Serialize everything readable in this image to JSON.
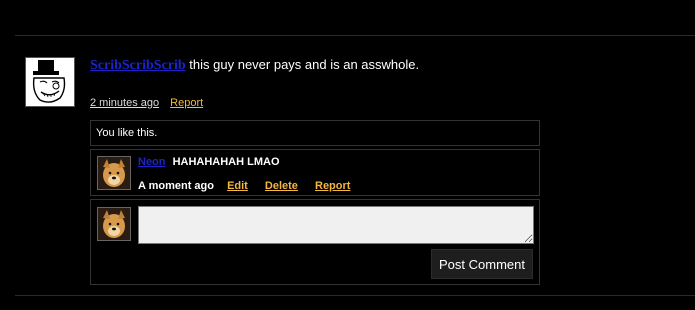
{
  "post": {
    "username": "ScribScribScrib",
    "text": "this guy never pays and is an asswhole.",
    "time": "2 minutes ago",
    "report_label": "Report"
  },
  "likes": {
    "text": "You like this."
  },
  "reply": {
    "username": "Neon",
    "text": "HAHAHAHAH LMAO",
    "time": "A moment ago",
    "edit_label": "Edit",
    "delete_label": "Delete",
    "report_label": "Report"
  },
  "compose": {
    "input_value": "",
    "button_label": "Post Comment"
  },
  "colors": {
    "background": "#000000",
    "username": "#1e22c8",
    "action_link": "#f4b73f"
  }
}
